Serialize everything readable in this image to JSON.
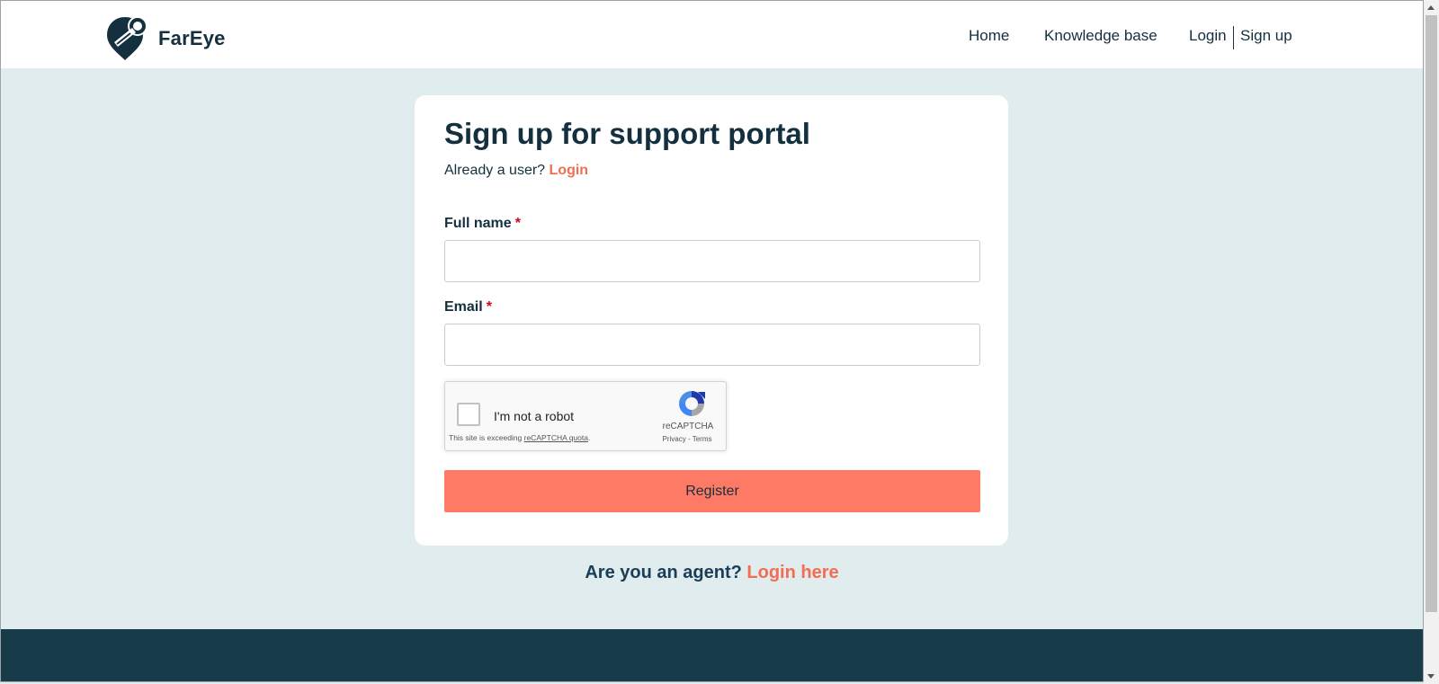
{
  "header": {
    "brand": "FarEye",
    "nav": {
      "home": "Home",
      "knowledge_base": "Knowledge base",
      "login": "Login",
      "signup": "Sign up"
    }
  },
  "form": {
    "title": "Sign up for support portal",
    "already_user": "Already a user?",
    "login_link": "Login",
    "full_name_label": "Full name",
    "email_label": "Email",
    "required_marker": "*",
    "full_name_value": "",
    "email_value": "",
    "captcha": {
      "label": "I'm not a robot",
      "quota_prefix": "This site is exceeding ",
      "quota_link": "reCAPTCHA quota",
      "quota_suffix": ".",
      "brand": "reCAPTCHA",
      "privacy": "Privacy",
      "sep": " - ",
      "terms": "Terms"
    },
    "register_label": "Register"
  },
  "agent": {
    "question": "Are you an agent?",
    "link": "Login here"
  },
  "colors": {
    "page_bg": "#e0eced",
    "accent": "#f26d52",
    "button": "#ff7a64",
    "dark": "#14303f",
    "footer": "#173b49"
  }
}
